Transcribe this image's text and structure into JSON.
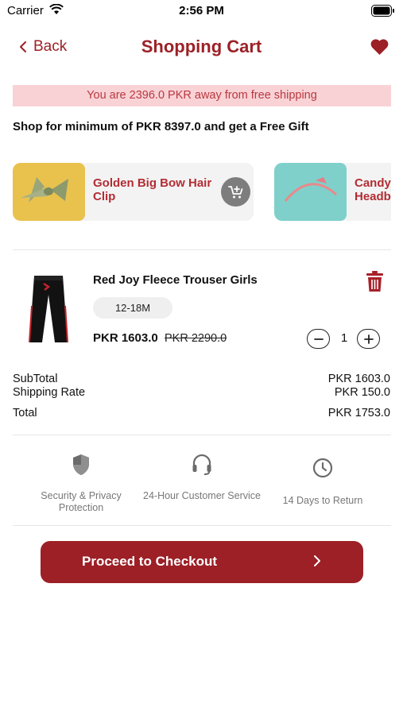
{
  "status_bar": {
    "carrier": "Carrier",
    "time": "2:56 PM"
  },
  "nav": {
    "back_label": "Back",
    "title": "Shopping Cart"
  },
  "banner": {
    "text": "You are 2396.0 PKR away from free shipping"
  },
  "gift_promo": {
    "text": "Shop for minimum of PKR 8397.0 and get a Free Gift"
  },
  "suggestions": [
    {
      "name": "Golden Big Bow Hair Clip"
    },
    {
      "name": "Candy Headb"
    }
  ],
  "cart_item": {
    "name": "Red Joy Fleece Trouser Girls",
    "size": "12-18M",
    "price": "PKR 1603.0",
    "old_price": "PKR 2290.0",
    "quantity": "1"
  },
  "summary": {
    "subtotal_label": "SubTotal",
    "subtotal_value": "PKR 1603.0",
    "shipping_label": "Shipping Rate",
    "shipping_value": "PKR 150.0",
    "total_label": "Total",
    "total_value": "PKR 1753.0"
  },
  "features": [
    {
      "icon": "shield-icon",
      "text": "Security & Privacy Protection"
    },
    {
      "icon": "headset-icon",
      "text": "24-Hour Customer Service"
    },
    {
      "icon": "clock-icon",
      "text": "14 Days to Return"
    }
  ],
  "checkout": {
    "label": "Proceed to Checkout"
  },
  "colors": {
    "brand": "#9c2026",
    "banner_bg": "#f9d2d6",
    "banner_text": "#b8393f"
  }
}
